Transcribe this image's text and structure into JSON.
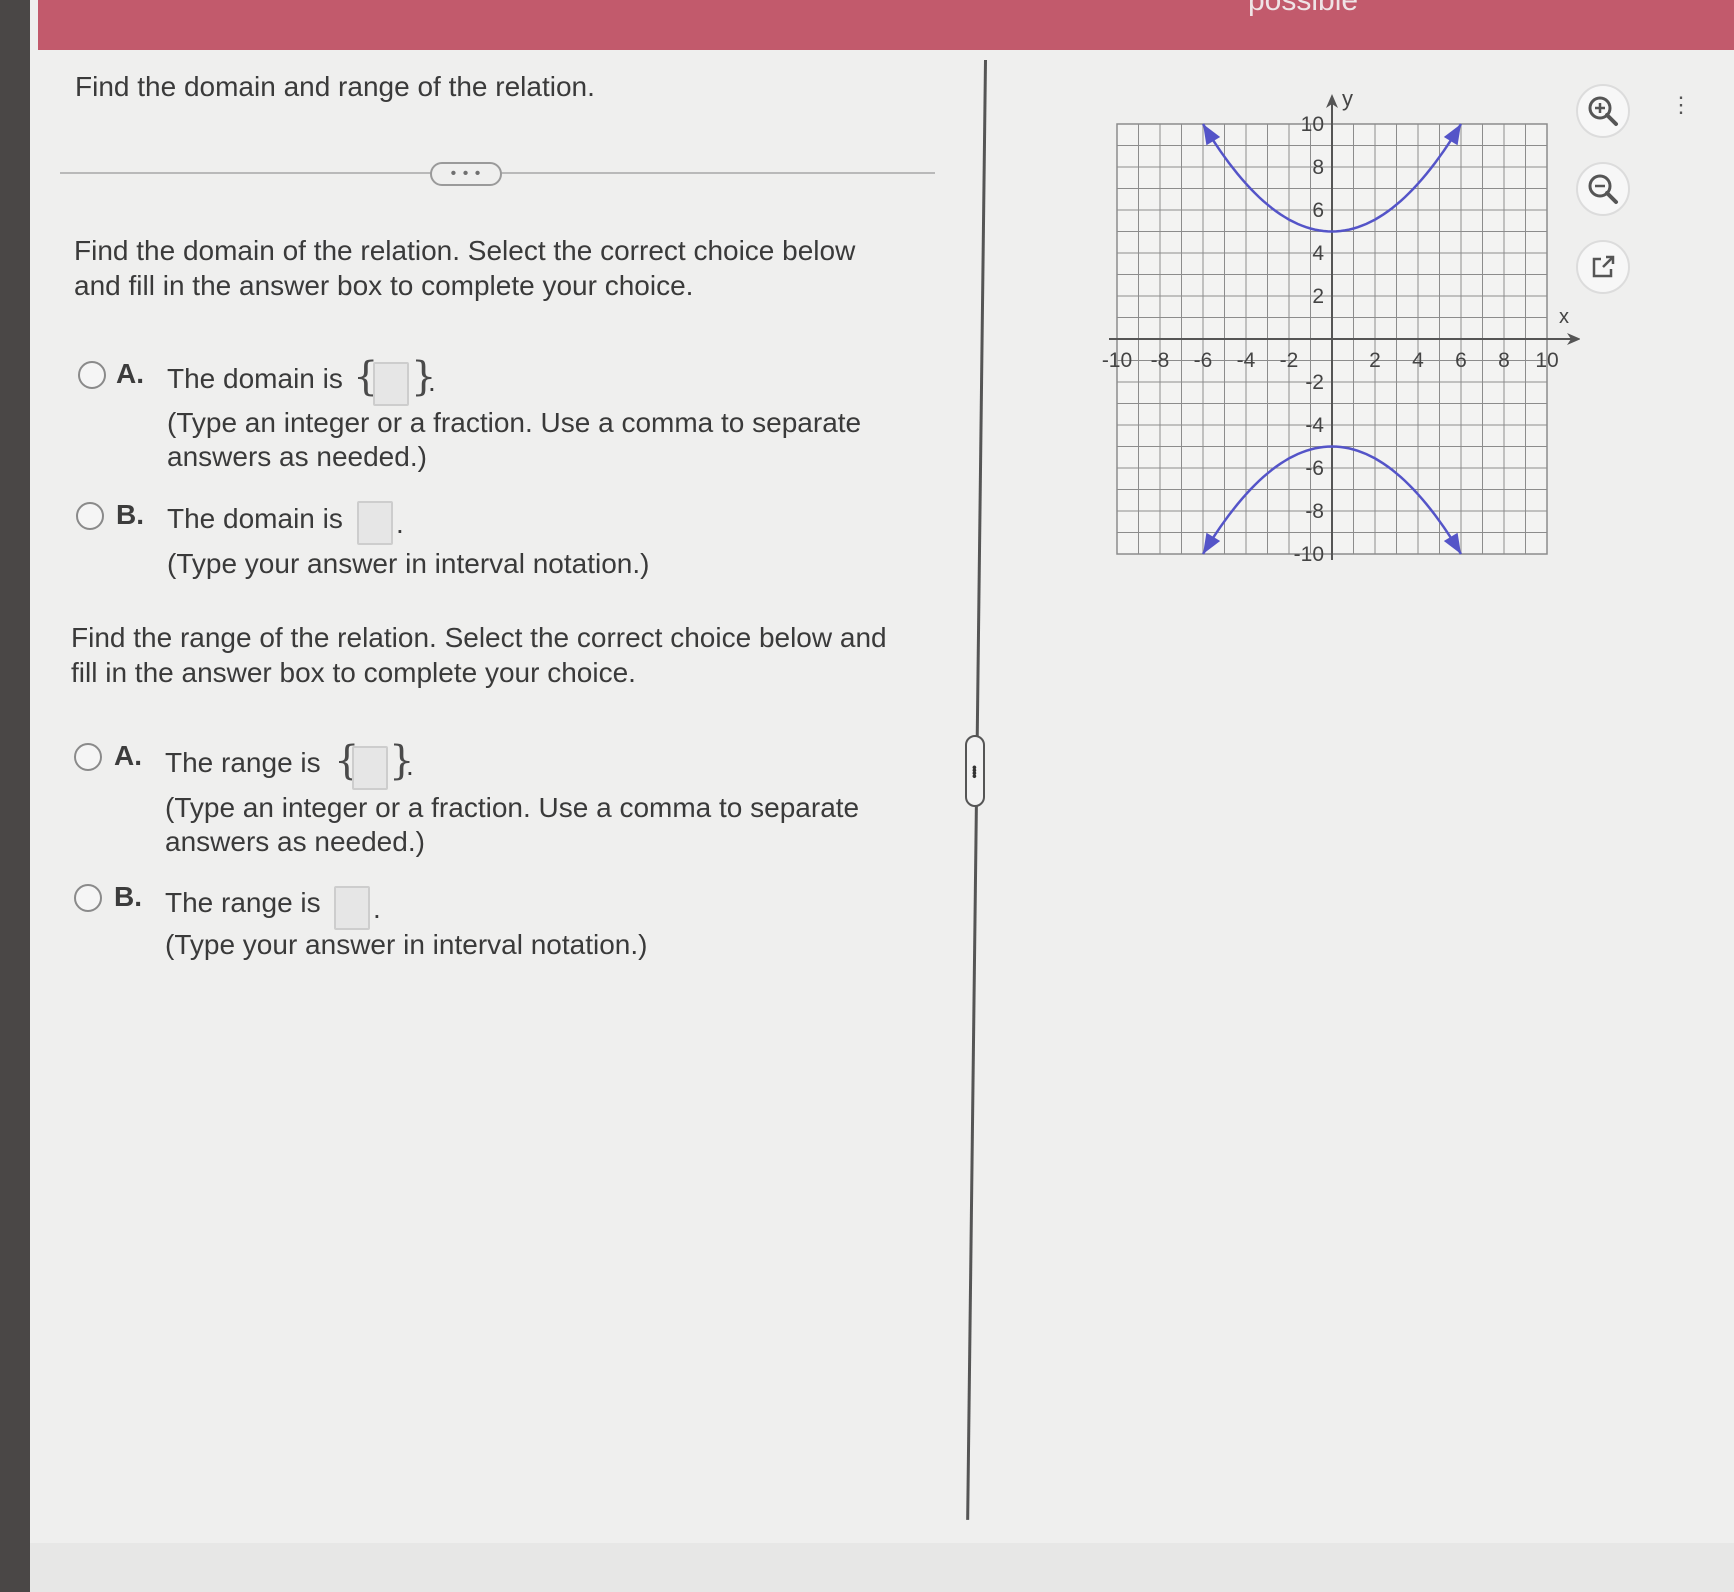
{
  "header": {
    "status_text": "possible"
  },
  "question": {
    "title": "Find the domain and range of the relation.",
    "expand_label": "• • •"
  },
  "domain_part": {
    "prompt_line1": "Find the domain of the relation. Select the correct choice below",
    "prompt_line2": "and fill in the answer box to complete your choice.",
    "choice_a": {
      "letter": "A.",
      "label": "The domain is",
      "open_brace": "{",
      "close_brace": "}",
      "period": ".",
      "hint_line1": "(Type an integer or a fraction. Use a comma to separate",
      "hint_line2": "answers as needed.)",
      "value": ""
    },
    "choice_b": {
      "letter": "B.",
      "label": "The domain is",
      "period": ".",
      "hint": "(Type your answer in interval notation.)",
      "value": ""
    }
  },
  "range_part": {
    "prompt_line1": "Find the range of the relation. Select the correct choice below and",
    "prompt_line2": "fill in the answer box to complete your choice.",
    "choice_a": {
      "letter": "A.",
      "label": "The range is",
      "open_brace": "{",
      "close_brace": "}",
      "period": ".",
      "hint_line1": "(Type an integer or a fraction. Use a comma to separate",
      "hint_line2": "answers as needed.)",
      "value": ""
    },
    "choice_b": {
      "letter": "B.",
      "label": "The range is",
      "period": ".",
      "hint": "(Type your answer in interval notation.)",
      "value": ""
    }
  },
  "graph": {
    "x_axis_label": "x",
    "y_axis_label": "y",
    "x_tick_labels": [
      "-10",
      "-8",
      "-6",
      "-4",
      "-2",
      "2",
      "4",
      "6",
      "8",
      "10"
    ],
    "y_tick_labels": [
      "10",
      "8",
      "6",
      "4",
      "2",
      "-2",
      "-4",
      "-6",
      "-8",
      "-10"
    ],
    "curve_color": "#5454c8",
    "grid_color": "#8c8c8c",
    "curves": [
      {
        "name": "upper-parabola",
        "vertex": [
          0,
          5
        ],
        "through": [
          [
            -6,
            10
          ],
          [
            6,
            10
          ]
        ],
        "opens": "up"
      },
      {
        "name": "lower-parabola",
        "vertex": [
          0,
          -5
        ],
        "through": [
          [
            -6,
            -10
          ],
          [
            6,
            -10
          ]
        ],
        "opens": "down"
      }
    ]
  },
  "tools": {
    "zoom_in": "zoom-in",
    "zoom_out": "zoom-out",
    "open_external": "open-in-new-window"
  },
  "accent": "#c25a6c"
}
